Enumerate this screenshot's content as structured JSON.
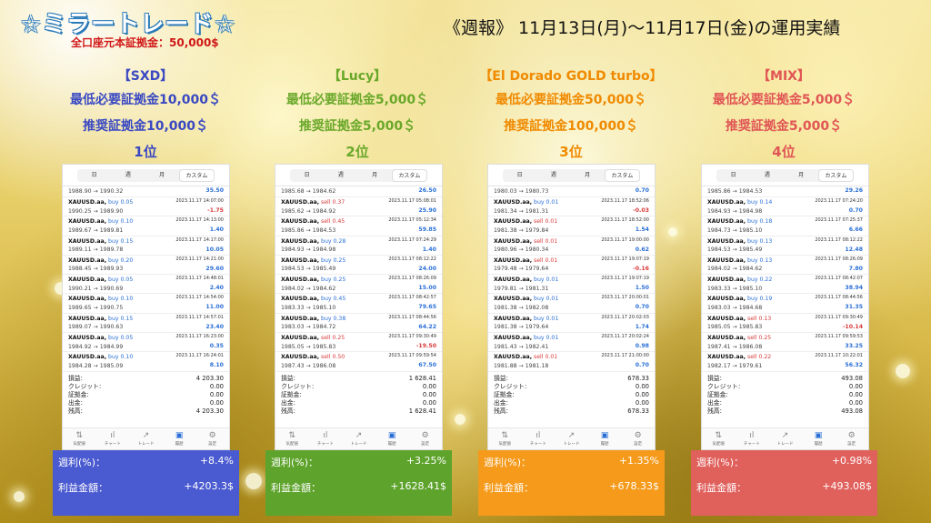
{
  "header": {
    "logo": "☆ミラートレード☆",
    "capital_note": "全口座元本証拠金：50,000$",
    "headline": "《週報》 11月13日(月)〜11月17日(金)の運用実績"
  },
  "colors": {
    "sxd": "#3a49c2",
    "lucy": "#6aa82a",
    "eldorado": "#f08a00",
    "mix": "#e05555",
    "box_sxd": "#4a5ad0",
    "box_lucy": "#5ea32c",
    "box_eldorado": "#f59a1a",
    "box_mix": "#e0605c"
  },
  "tabs": [
    "日",
    "週",
    "月",
    "カスタム"
  ],
  "nav": [
    {
      "icon": "quotes-icon",
      "glyph": "⇅",
      "label": "気配値"
    },
    {
      "icon": "chart-icon",
      "glyph": "ıl",
      "label": "チャート"
    },
    {
      "icon": "trade-icon",
      "glyph": "↗",
      "label": "トレード"
    },
    {
      "icon": "history-icon",
      "glyph": "▣",
      "label": "履歴"
    },
    {
      "icon": "settings-icon",
      "glyph": "⚙",
      "label": "設定"
    }
  ],
  "summary_labels": [
    "損益:",
    "クレジット:",
    "証拠金:",
    "出金:",
    "残高:"
  ],
  "result_labels": {
    "weekly": "週利(%)：",
    "profit": "利益金額："
  },
  "strategies": [
    {
      "name": "【SXD】",
      "min": "最低必要証拠金10,000＄",
      "rec": "推奨証拠金10,000＄",
      "rank": "1位",
      "partial": {
        "prices": "1988.90 → 1990.32",
        "pl": "35.50"
      },
      "trades": [
        {
          "sym": "XAUUSD.aa,",
          "side": "buy",
          "lot": "0.05",
          "dt": "2023.11.17 14:07:00",
          "prices": "1990.25 → 1989.90",
          "pl": "-1.75"
        },
        {
          "sym": "XAUUSD.aa,",
          "side": "buy",
          "lot": "0.10",
          "dt": "2023.11.17 14:13:00",
          "prices": "1989.67 → 1989.81",
          "pl": "1.40"
        },
        {
          "sym": "XAUUSD.aa,",
          "side": "buy",
          "lot": "0.15",
          "dt": "2023.11.17 14:17:00",
          "prices": "1989.11 → 1989.78",
          "pl": "10.05"
        },
        {
          "sym": "XAUUSD.aa,",
          "side": "buy",
          "lot": "0.20",
          "dt": "2023.11.17 14:21:00",
          "prices": "1988.45 → 1989.93",
          "pl": "29.60"
        },
        {
          "sym": "XAUUSD.aa,",
          "side": "buy",
          "lot": "0.05",
          "dt": "2023.11.17 14:48:01",
          "prices": "1990.21 → 1990.69",
          "pl": "2.40"
        },
        {
          "sym": "XAUUSD.aa,",
          "side": "buy",
          "lot": "0.10",
          "dt": "2023.11.17 14:54:00",
          "prices": "1989.65 → 1990.75",
          "pl": "11.00"
        },
        {
          "sym": "XAUUSD.aa,",
          "side": "buy",
          "lot": "0.15",
          "dt": "2023.11.17 14:57:01",
          "prices": "1989.07 → 1990.63",
          "pl": "23.40"
        },
        {
          "sym": "XAUUSD.aa,",
          "side": "buy",
          "lot": "0.05",
          "dt": "2023.11.17 16:23:00",
          "prices": "1984.92 → 1984.99",
          "pl": "0.35"
        },
        {
          "sym": "XAUUSD.aa,",
          "side": "buy",
          "lot": "0.10",
          "dt": "2023.11.17 16:24:01",
          "prices": "1984.28 → 1985.09",
          "pl": "8.10"
        }
      ],
      "summary": [
        "4 203.30",
        "0.00",
        "0.00",
        "0.00",
        "4 203.30"
      ],
      "weekly": "+8.4%",
      "profit": "+4203.3$"
    },
    {
      "name": "【Lucy】",
      "min": "最低必要証拠金5,000＄",
      "rec": "推奨証拠金5,000＄",
      "rank": "2位",
      "partial": {
        "prices": "1985.68 → 1984.62",
        "pl": "26.50"
      },
      "trades": [
        {
          "sym": "XAUUSD.aa,",
          "side": "sell",
          "lot": "0.37",
          "dt": "2023.11.17 05:08:01",
          "prices": "1985.62 → 1984.92",
          "pl": "25.90"
        },
        {
          "sym": "XAUUSD.aa,",
          "side": "sell",
          "lot": "0.45",
          "dt": "2023.11.17 05:12:34",
          "prices": "1985.86 → 1984.53",
          "pl": "59.85"
        },
        {
          "sym": "XAUUSD.aa,",
          "side": "buy",
          "lot": "0.28",
          "dt": "2023.11.17 07:24:29",
          "prices": "1984.93 → 1984.98",
          "pl": "1.40"
        },
        {
          "sym": "XAUUSD.aa,",
          "side": "buy",
          "lot": "0.25",
          "dt": "2023.11.17 08:12:22",
          "prices": "1984.53 → 1985.49",
          "pl": "24.00"
        },
        {
          "sym": "XAUUSD.aa,",
          "side": "buy",
          "lot": "0.25",
          "dt": "2023.11.17 08:26:09",
          "prices": "1984.02 → 1984.62",
          "pl": "15.00"
        },
        {
          "sym": "XAUUSD.aa,",
          "side": "buy",
          "lot": "0.45",
          "dt": "2023.11.17 08:42:57",
          "prices": "1983.33 → 1985.10",
          "pl": "79.65"
        },
        {
          "sym": "XAUUSD.aa,",
          "side": "buy",
          "lot": "0.38",
          "dt": "2023.11.17 08:44:56",
          "prices": "1983.03 → 1984.72",
          "pl": "64.22"
        },
        {
          "sym": "XAUUSD.aa,",
          "side": "sell",
          "lot": "0.25",
          "dt": "2023.11.17 09:30:49",
          "prices": "1985.05 → 1985.83",
          "pl": "-19.50"
        },
        {
          "sym": "XAUUSD.aa,",
          "side": "sell",
          "lot": "0.50",
          "dt": "2023.11.17 09:59:54",
          "prices": "1987.43 → 1986.08",
          "pl": "67.50"
        }
      ],
      "summary": [
        "1 628.41",
        "0.00",
        "0.00",
        "0.00",
        "1 628.41"
      ],
      "weekly": "+3.25%",
      "profit": "+1628.41$"
    },
    {
      "name": "【El Dorado GOLD turbo】",
      "min": "最低必要証拠金50,000＄",
      "rec": "推奨証拠金100,000＄",
      "rank": "3位",
      "partial": {
        "prices": "1980.03 → 1980.73",
        "pl": "0.70"
      },
      "trades": [
        {
          "sym": "XAUUSD.aa,",
          "side": "buy",
          "lot": "0.01",
          "dt": "2023.11.17 18:52:06",
          "prices": "1981.34 → 1981.31",
          "pl": "-0.03"
        },
        {
          "sym": "XAUUSD.aa,",
          "side": "sell",
          "lot": "0.01",
          "dt": "2023.11.17 18:52:00",
          "prices": "1981.38 → 1979.84",
          "pl": "1.54"
        },
        {
          "sym": "XAUUSD.aa,",
          "side": "sell",
          "lot": "0.01",
          "dt": "2023.11.17 19:00:00",
          "prices": "1980.96 → 1980.34",
          "pl": "0.62"
        },
        {
          "sym": "XAUUSD.aa,",
          "side": "sell",
          "lot": "0.01",
          "dt": "2023.11.17 19:07:19",
          "prices": "1979.48 → 1979.64",
          "pl": "-0.16"
        },
        {
          "sym": "XAUUSD.aa,",
          "side": "buy",
          "lot": "0.01",
          "dt": "2023.11.17 19:07:19",
          "prices": "1979.81 → 1981.31",
          "pl": "1.50"
        },
        {
          "sym": "XAUUSD.aa,",
          "side": "buy",
          "lot": "0.01",
          "dt": "2023.11.17 20:00:01",
          "prices": "1981.38 → 1982.08",
          "pl": "0.70"
        },
        {
          "sym": "XAUUSD.aa,",
          "side": "buy",
          "lot": "0.01",
          "dt": "2023.11.17 20:02:03",
          "prices": "1981.38 → 1979.64",
          "pl": "1.74"
        },
        {
          "sym": "XAUUSD.aa,",
          "side": "buy",
          "lot": "0.01",
          "dt": "2023.11.17 20:02:24",
          "prices": "1981.43 → 1982.41",
          "pl": "0.98"
        },
        {
          "sym": "XAUUSD.aa,",
          "side": "sell",
          "lot": "0.01",
          "dt": "2023.11.17 21:00:00",
          "prices": "1981.88 → 1981.18",
          "pl": "0.70"
        }
      ],
      "summary": [
        "678.33",
        "0.00",
        "0.00",
        "0.00",
        "678.33"
      ],
      "weekly": "+1.35%",
      "profit": "+678.33$"
    },
    {
      "name": "【MIX】",
      "min": "最低必要証拠金5,000＄",
      "rec": "推奨証拠金5,000＄",
      "rank": "4位",
      "partial": {
        "prices": "1985.86 → 1984.53",
        "pl": "29.26"
      },
      "trades": [
        {
          "sym": "XAUUSD.aa,",
          "side": "buy",
          "lot": "0.14",
          "dt": "2023.11.17 07:24:20",
          "prices": "1984.93 → 1984.98",
          "pl": "0.70"
        },
        {
          "sym": "XAUUSD.aa,",
          "side": "buy",
          "lot": "0.18",
          "dt": "2023.11.17 07:25:37",
          "prices": "1984.73 → 1985.10",
          "pl": "6.66"
        },
        {
          "sym": "XAUUSD.aa,",
          "side": "buy",
          "lot": "0.13",
          "dt": "2023.11.17 08:12:22",
          "prices": "1984.53 → 1985.49",
          "pl": "12.48"
        },
        {
          "sym": "XAUUSD.aa,",
          "side": "buy",
          "lot": "0.13",
          "dt": "2023.11.17 08:26:09",
          "prices": "1984.02 → 1984.62",
          "pl": "7.80"
        },
        {
          "sym": "XAUUSD.aa,",
          "side": "buy",
          "lot": "0.22",
          "dt": "2023.11.17 08:42:07",
          "prices": "1983.33 → 1985.10",
          "pl": "38.94"
        },
        {
          "sym": "XAUUSD.aa,",
          "side": "buy",
          "lot": "0.19",
          "dt": "2023.11.17 08:44:56",
          "prices": "1983.03 → 1984.68",
          "pl": "31.35"
        },
        {
          "sym": "XAUUSD.aa,",
          "side": "sell",
          "lot": "0.13",
          "dt": "2023.11.17 09:30:49",
          "prices": "1985.05 → 1985.83",
          "pl": "-10.14"
        },
        {
          "sym": "XAUUSD.aa,",
          "side": "sell",
          "lot": "0.25",
          "dt": "2023.11.17 09:59:53",
          "prices": "1987.41 → 1986.08",
          "pl": "33.25"
        },
        {
          "sym": "XAUUSD.aa,",
          "side": "sell",
          "lot": "0.22",
          "dt": "2023.11.17 10:22:01",
          "prices": "1982.17 → 1979.61",
          "pl": "56.32"
        }
      ],
      "summary": [
        "493.08",
        "0.00",
        "0.00",
        "0.00",
        "493.08"
      ],
      "weekly": "+0.98%",
      "profit": "+493.08$"
    }
  ]
}
